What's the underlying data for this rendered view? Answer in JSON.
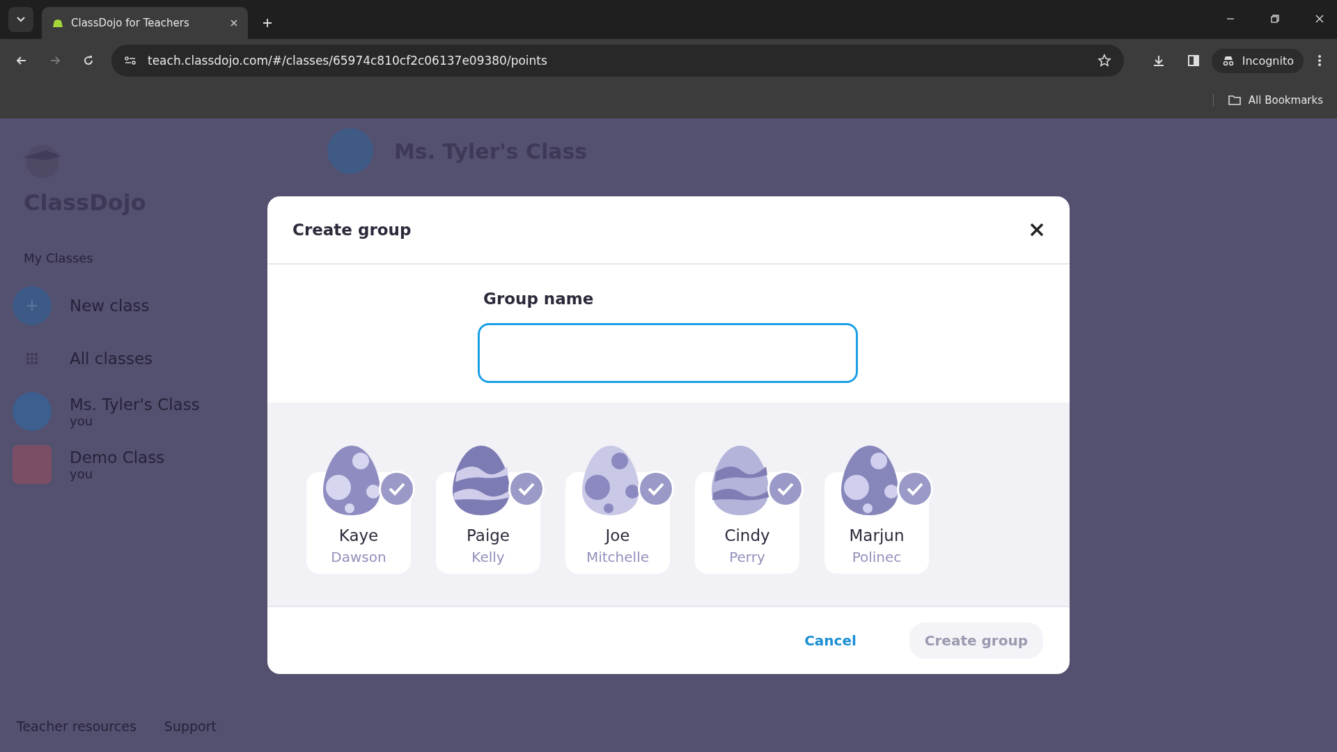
{
  "browser": {
    "tab_title": "ClassDojo for Teachers",
    "url": "teach.classdojo.com/#/classes/65974c810cf2c06137e09380/points",
    "profile": "Incognito",
    "bookmarks": "All Bookmarks"
  },
  "sidebar": {
    "brand": "ClassDojo",
    "section": "My Classes",
    "items": [
      {
        "kind": "add",
        "label": "New class"
      },
      {
        "kind": "grid",
        "label": "All classes"
      },
      {
        "kind": "class",
        "label": "Ms. Tyler's Class",
        "sub": "you",
        "color": "#3d5f8f"
      },
      {
        "kind": "class",
        "label": "Demo Class",
        "sub": "you",
        "color": "#7a4f66"
      }
    ],
    "footer": [
      "Teacher resources",
      "Support"
    ]
  },
  "header": {
    "title": "Ms. Tyler's Class"
  },
  "dialog": {
    "title": "Create group",
    "field_label": "Group name",
    "students": [
      {
        "first": "Kaye",
        "last": "Dawson",
        "selected": true
      },
      {
        "first": "Paige",
        "last": "Kelly",
        "selected": true
      },
      {
        "first": "Joe",
        "last": "Mitchelle",
        "selected": true
      },
      {
        "first": "Cindy",
        "last": "Perry",
        "selected": true
      },
      {
        "first": "Marjun",
        "last": "Polinec",
        "selected": true
      }
    ],
    "cancel": "Cancel",
    "submit": {
      "label": "Create group",
      "disabled": true
    }
  }
}
